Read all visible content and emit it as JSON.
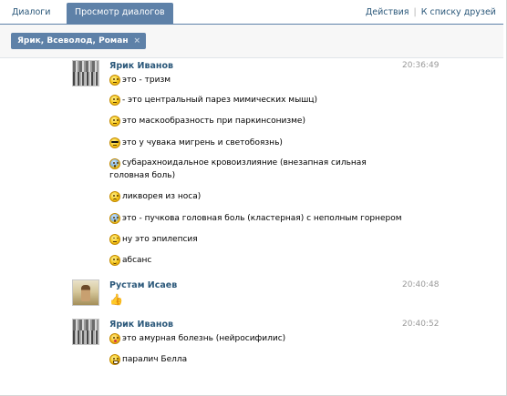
{
  "tabs": [
    {
      "label": "Диалоги",
      "active": false
    },
    {
      "label": "Просмотр диалогов",
      "active": true
    }
  ],
  "actions": {
    "actions_label": "Действия",
    "to_friends_label": "К списку друзей"
  },
  "chip": {
    "label": "Ярик, Всеволод, Роман",
    "close": "×"
  },
  "messages": [
    {
      "author": "Ярик Иванов",
      "time": "20:36:49",
      "avatar": "group-photo",
      "lines": [
        {
          "icon": "neutral-emoji",
          "text": "это - тризм"
        },
        {
          "icon": "neutral-emoji",
          "text": "- это центральный парез мимических мышц)"
        },
        {
          "icon": "neutral-emoji",
          "text": "это маскообразность при паркинсонизме)"
        },
        {
          "icon": "sunglasses-emoji",
          "text": "это у чувака мигрень и светобоязнь)"
        },
        {
          "icon": "scream-emoji",
          "text": "субарахноидальное кровоизлияние (внезапная сильная головная боль)"
        },
        {
          "icon": "sad-emoji",
          "text": "ликворея из носа)"
        },
        {
          "icon": "scream-emoji",
          "text": "это - пучкова головная боль (кластерная) с неполным горнером"
        },
        {
          "icon": "wink-emoji",
          "text": "ну это эпилепсия"
        },
        {
          "icon": "smile-emoji",
          "text": "абсанс"
        }
      ]
    },
    {
      "author": "Рустам Исаев",
      "time": "20:40:48",
      "avatar": "person-photo",
      "lines": [
        {
          "icon": "thumbs-up-emoji",
          "text": ""
        }
      ]
    },
    {
      "author": "Ярик Иванов",
      "time": "20:40:52",
      "avatar": "group-photo",
      "lines": [
        {
          "icon": "kiss-emoji",
          "text": "это амурная болезнь (нейросифилис)"
        },
        {
          "icon": "grin-emoji",
          "text": "паралич Белла"
        }
      ]
    }
  ],
  "colors": {
    "accent": "#5e81a8",
    "link": "#2b587a",
    "time": "#999999"
  }
}
